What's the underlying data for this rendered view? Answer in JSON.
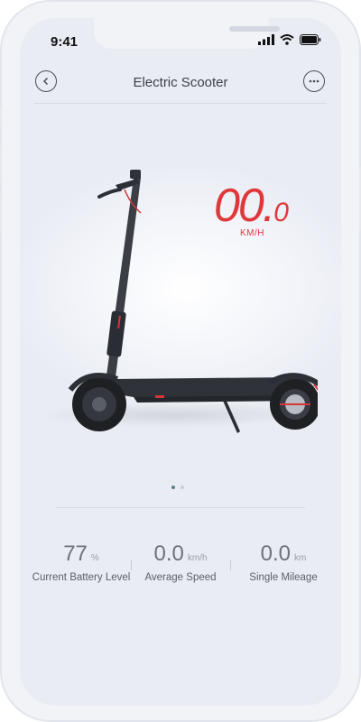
{
  "status_bar": {
    "time": "9:41"
  },
  "nav": {
    "title": "Electric Scooter"
  },
  "speedometer": {
    "value_main": "00.",
    "value_decimal": "0",
    "unit": "KM/H"
  },
  "pager": {
    "count": 2,
    "active": 0
  },
  "stats": [
    {
      "value": "77",
      "unit": "%",
      "label": "Current Battery Level"
    },
    {
      "value": "0.0",
      "unit": "km/h",
      "label": "Average Speed"
    },
    {
      "value": "0.0",
      "unit": "km",
      "label": "Single Mileage"
    }
  ],
  "colors": {
    "accent": "#e0383a",
    "text": "#3c3f46",
    "muted": "#6f7279"
  }
}
